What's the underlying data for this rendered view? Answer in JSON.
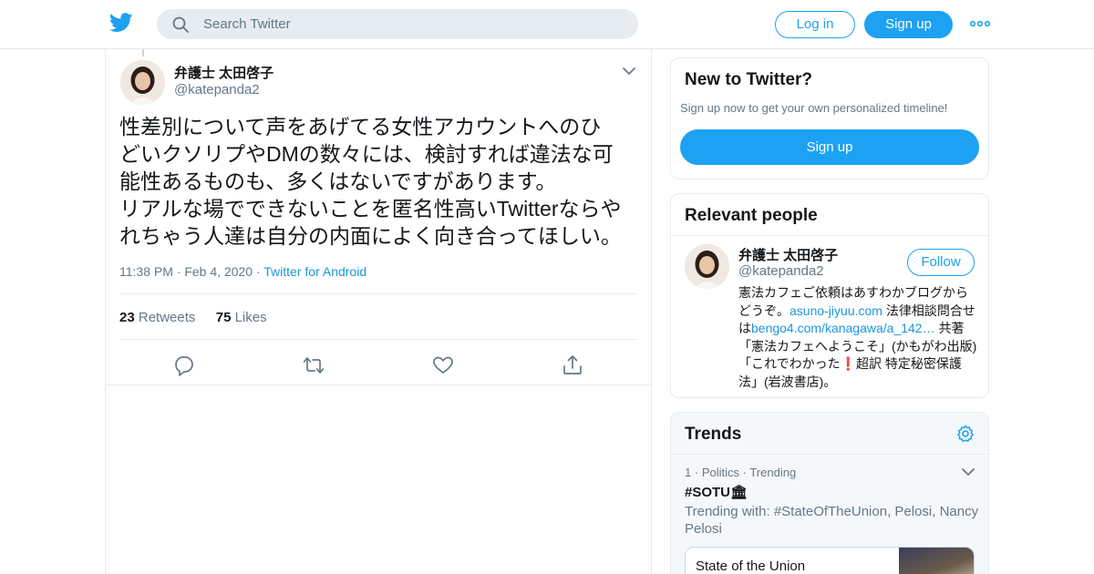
{
  "header": {
    "search_placeholder": "Search Twitter",
    "login_label": "Log in",
    "signup_label": "Sign up",
    "brand_color": "#1da1f2"
  },
  "tweet": {
    "author_name": "弁護士 太田啓子",
    "author_handle": "@katepanda2",
    "text_lines": [
      "性差別について声をあげてる女性アカウントへのひ",
      "どいクソリプやDMの数々には、検討すれば違法な可",
      "能性あるものも、多くはないですがあります。",
      "リアルな場でできないことを匿名性高いTwitterならや",
      "れちゃう人達は自分の内面によく向き合ってほしい。"
    ],
    "time": "11:38 PM",
    "date": "Feb 4, 2020",
    "source": "Twitter for Android",
    "retweets_count": "23",
    "retweets_label": "Retweets",
    "likes_count": "75",
    "likes_label": "Likes"
  },
  "sidebar": {
    "new_to_twitter": {
      "title": "New to Twitter?",
      "subtitle": "Sign up now to get your own personalized timeline!",
      "cta": "Sign up"
    },
    "relevant_people": {
      "title": "Relevant people",
      "name": "弁護士 太田啓子",
      "handle": "@katepanda2",
      "follow_label": "Follow",
      "bio_parts": {
        "p1": "憲法カフェご依頼はあすわかブログからどうぞ。",
        "link1": "asuno-jiyuu.com",
        "p2": " 法律相談問合せは",
        "link2": "bengo4.com/kanagawa/a_142…",
        "p3": " 共著「憲法カフェへようこそ」(かもがわ出版)「これでわかった",
        "emoji": "❗",
        "p4": "超訳 特定秘密保護法」(岩波書店)。"
      }
    },
    "trends": {
      "title": "Trends",
      "rank": "1",
      "category": "Politics",
      "status": "Trending",
      "tag": "#SOTU🏛",
      "description": "Trending with: #StateOfTheUnion, Pelosi, Nancy Pelosi",
      "card_title": "State of the Union"
    }
  }
}
